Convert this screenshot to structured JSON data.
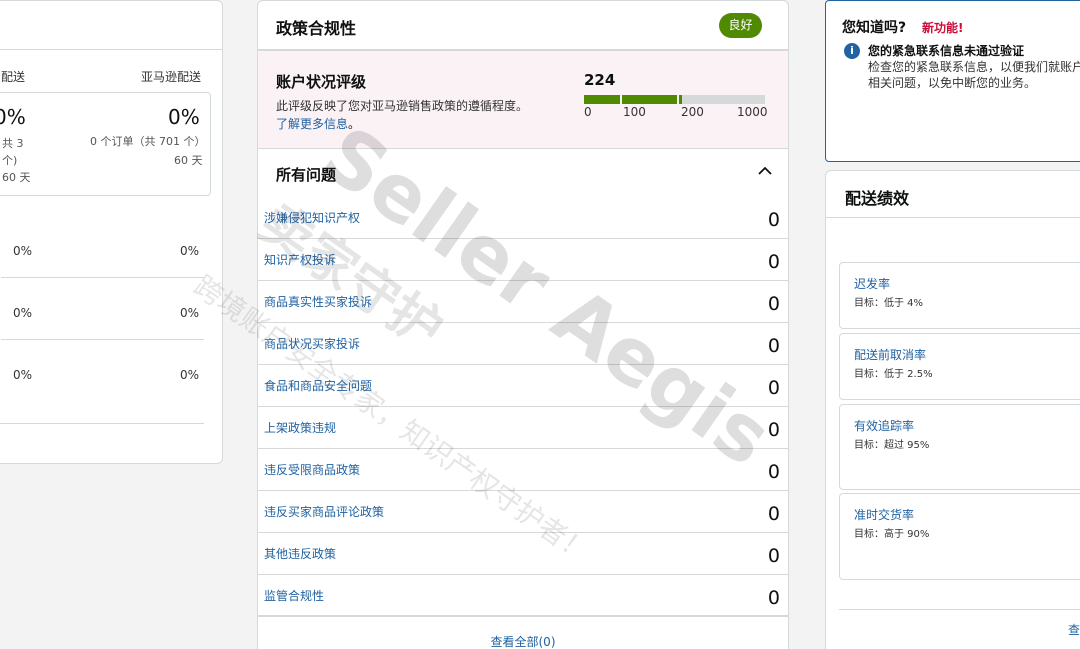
{
  "left_panel": {
    "col1_head": "配送",
    "col2_head": "亚马逊配送",
    "col1_big": "0%",
    "col1_small1": "共 3",
    "col1_small2": "个)",
    "col1_small3": "60 天",
    "col2_big": "0%",
    "col2_small1": "0 个订单（共 701 个）",
    "col2_small2": "60 天",
    "rows": [
      {
        "a": "0%",
        "b": "0%"
      },
      {
        "a": "0%",
        "b": "0%"
      },
      {
        "a": "0%",
        "b": "0%"
      }
    ]
  },
  "policy": {
    "title": "政策合规性",
    "badge": "良好",
    "rating_title": "账户状况评级",
    "rating_desc": "此评级反映了您对亚马逊销售政策的遵循程度。",
    "rating_link": "了解更多信息",
    "rating_link_suffix": "。",
    "score": "224",
    "score_max": 1000,
    "ticks": [
      "0",
      "100",
      "200",
      "1000"
    ],
    "colors": {
      "good": "#508a00",
      "track": "#d5d9d9",
      "badge": "#508a00"
    },
    "issues_title": "所有问题",
    "issues": [
      {
        "label": "涉嫌侵犯知识产权",
        "value": "0"
      },
      {
        "label": "知识产权投诉",
        "value": "0"
      },
      {
        "label": "商品真实性买家投诉",
        "value": "0"
      },
      {
        "label": "商品状况买家投诉",
        "value": "0"
      },
      {
        "label": "食品和商品安全问题",
        "value": "0"
      },
      {
        "label": "上架政策违规",
        "value": "0"
      },
      {
        "label": "违反受限商品政策",
        "value": "0"
      },
      {
        "label": "违反买家商品评论政策",
        "value": "0"
      },
      {
        "label": "其他违反政策",
        "value": "0"
      },
      {
        "label": "监管合规性",
        "value": "0"
      }
    ],
    "view_all": "查看全部(0)"
  },
  "notice": {
    "question": "您知道吗?",
    "new_label": "新功能!",
    "icon": "info-icon",
    "headline": "您的紧急联系信息未通过验证",
    "body": "检查您的紧急联系信息，以便我们就账户状况相关问题，以免中断您的业务。"
  },
  "delivery": {
    "title": "配送绩效",
    "metrics": [
      {
        "name": "迟发率",
        "target": "目标：低于 4%"
      },
      {
        "name": "配送前取消率",
        "target": "目标：低于 2.5%"
      },
      {
        "name": "有效追踪率",
        "target": "目标：超过 95%"
      },
      {
        "name": "准时交货率",
        "target": "目标：高于 90%"
      }
    ],
    "more": "查看"
  },
  "watermark": {
    "line1": "Seller Aegis",
    "line2": "卖家守护",
    "line3": "跨境账户安全专家，知识产权守护者！"
  }
}
